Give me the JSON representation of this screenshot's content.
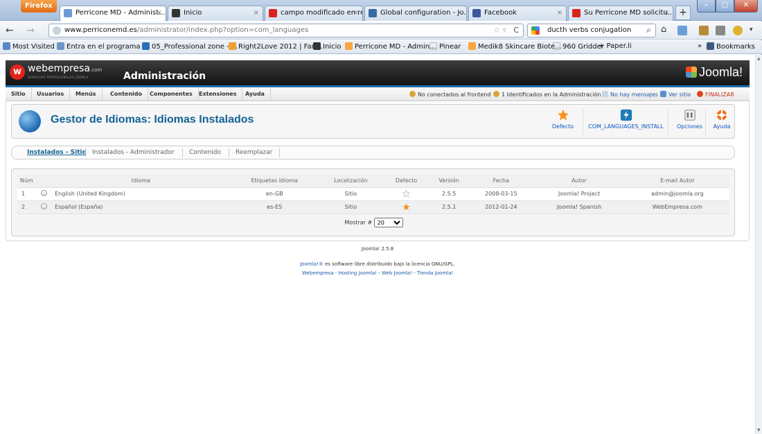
{
  "browser": {
    "app_button": "Firefox",
    "tabs": [
      {
        "title": "Perricone MD - Administ...",
        "color": "#6a9bd8"
      },
      {
        "title": "Inicio",
        "color": "#333333"
      },
      {
        "title": "campo modificado en re...",
        "color": "#d9231e"
      },
      {
        "title": "Global configuration - Jo...",
        "color": "#3b6aa0"
      },
      {
        "title": "Facebook",
        "color": "#3b5998"
      },
      {
        "title": "Su Perricone MD solicitu...",
        "color": "#d9231e"
      }
    ],
    "new_tab": "+",
    "url_domain": "www.perriconemd.es",
    "url_path": "/administrator/index.php?option=com_languages",
    "search_value": "ducth verbs conjugation",
    "bookmarks": [
      "Most Visited",
      "Entra en el programa ...",
      "05_Professional zone - ...",
      "Right2Love 2012 | Fam...",
      "Inicio",
      "Perricone MD - Admin...",
      "Pinear",
      "Medik8 Skincare Biote...",
      "960 Gridder",
      "+ Paper.li"
    ],
    "bookmarks_overflow": "»",
    "bookmarks_menu": "Bookmarks"
  },
  "header": {
    "brand": "webempresa",
    "brand_suffix": ".com",
    "brand_tagline": "SERVICIOS PROFESIONALES JOOMLA",
    "admin_title": "Administración",
    "joomla_logo": "Joomla!"
  },
  "menu": {
    "items": [
      "Sitio",
      "Usuarios",
      "Menús",
      "Contenido",
      "Componentes",
      "Extensiones",
      "Ayuda"
    ],
    "status": {
      "frontend": "No conectados al frontend",
      "admin": "1 Identificados en la Administración",
      "messages": "No hay mensajes",
      "view_site": "Ver sitio",
      "logout": "FINALIZAR"
    }
  },
  "toolbar": {
    "title": "Gestor de Idiomas: Idiomas Instalados",
    "buttons": [
      "Defecto",
      "COM_LANGUAGES_INSTALL",
      "Opciones",
      "Ayuda"
    ]
  },
  "subtabs": [
    "Instalados - Sitio",
    "Instalados - Administrador",
    "Contenido",
    "Reemplazar"
  ],
  "table": {
    "headers": [
      "Núm",
      "Idioma",
      "Etiquetas Idioma",
      "Localización",
      "Defecto",
      "Versión",
      "Fecha",
      "Autor",
      "E-mail Autor"
    ],
    "rows": [
      {
        "num": "1",
        "language": "English (United Kingdom)",
        "tag": "en-GB",
        "location": "Sitio",
        "default": false,
        "version": "2.5.5",
        "date": "2008-03-15",
        "author": "Joomla! Project",
        "email": "admin@joomla.org"
      },
      {
        "num": "2",
        "language": "Español (España)",
        "tag": "es-ES",
        "location": "Sitio",
        "default": true,
        "version": "2.5.1",
        "date": "2012-01-24",
        "author": "Joomla! Spanish",
        "email": "WebEmpresa.com"
      }
    ],
    "pager_label": "Mostrar #",
    "pager_value": "20"
  },
  "footer": {
    "version": "Joomla! 2.5.8",
    "license_link": "Joomla!®",
    "license_text": " es software libre distribuido bajo la licencia GNU/GPL.",
    "links": "Webempresa - Hosting Joomla! - Web Joomla! - Tienda Joomla!"
  },
  "colors": {
    "accent": "#146295",
    "link": "#1a5aa8",
    "header_bg": "#1e1e1e",
    "star": "#f7931e"
  }
}
